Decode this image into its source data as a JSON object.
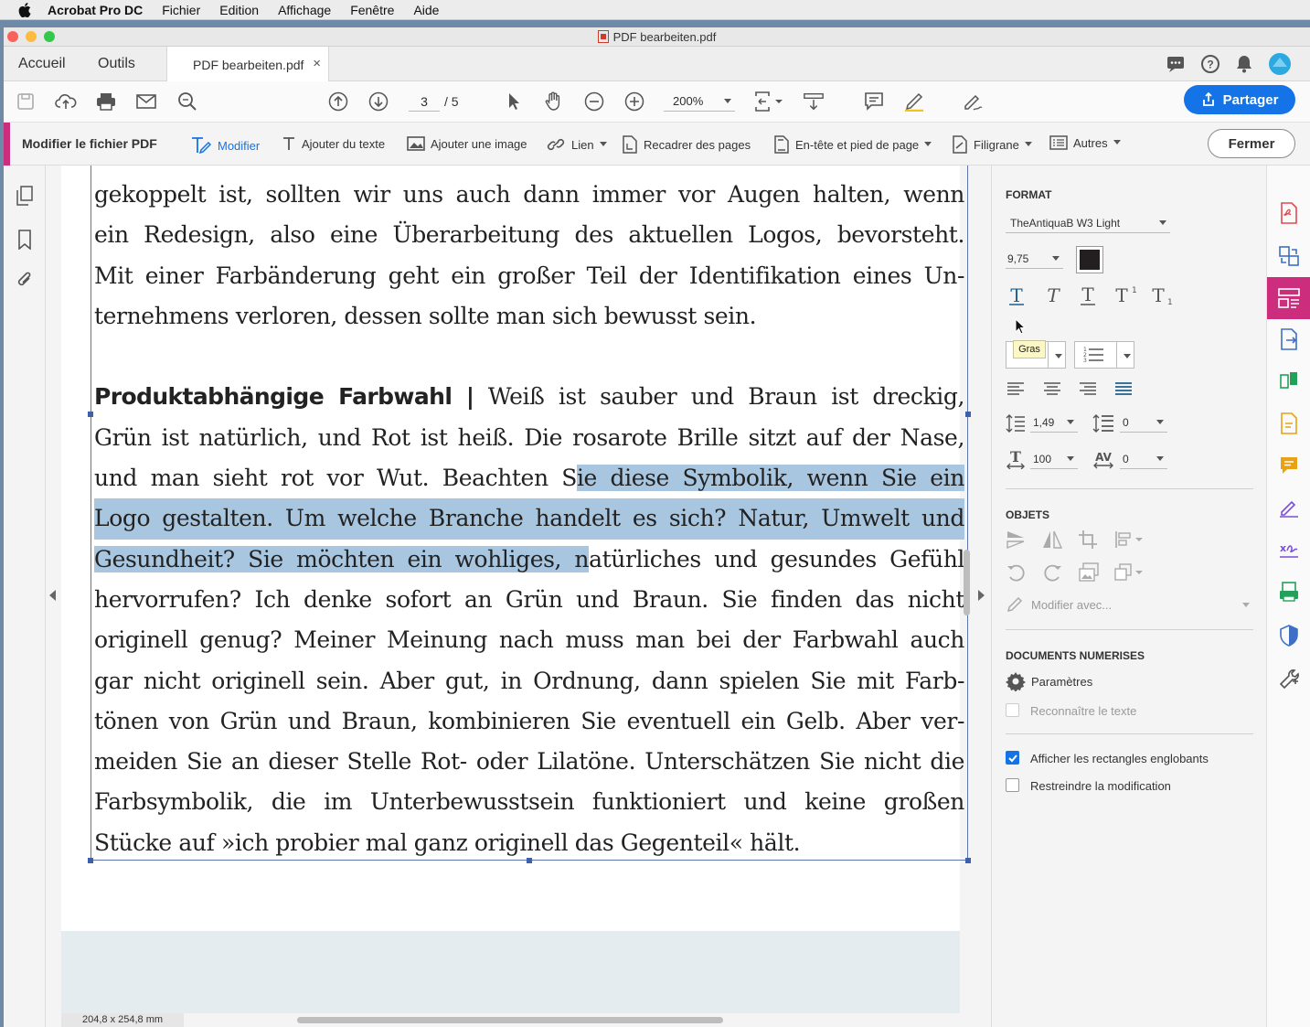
{
  "menubar": {
    "app": "Acrobat Pro DC",
    "items": [
      "Fichier",
      "Edition",
      "Affichage",
      "Fenêtre",
      "Aide"
    ]
  },
  "window": {
    "title": "PDF bearbeiten.pdf"
  },
  "tabs": {
    "home": "Accueil",
    "tools": "Outils",
    "doc": "PDF bearbeiten.pdf"
  },
  "toolbar": {
    "page_current": "3",
    "page_total": "/ 5",
    "zoom": "200%",
    "share": "Partager"
  },
  "edit_toolbar": {
    "title": "Modifier le fichier PDF",
    "modify": "Modifier",
    "add_text": "Ajouter du texte",
    "add_image": "Ajouter une image",
    "link": "Lien",
    "crop": "Recadrer des pages",
    "header_footer": "En-tête et pied de page",
    "watermark": "Filigrane",
    "more": "Autres",
    "close": "Fermer"
  },
  "document": {
    "lines": [
      "gekoppelt ist, sollten wir uns auch dann immer vor Augen halten, wenn",
      "ein Redesign, also eine Überarbeitung des aktuellen Logos, bevorsteht.",
      "Mit einer Farbänderung geht ein großer Teil der Identifikation eines Un-",
      "ternehmens verloren, dessen sollte man sich bewusst sein."
    ],
    "heading": "Produktabhängige Farbwahl",
    "heading_sep": "|",
    "p2_line1_rest": "Weiß ist sauber und Braun ist dreckig,",
    "p2_line2": "Grün ist natürlich, und Rot ist heiß. Die rosarote Brille sitzt auf der Nase,",
    "p2_line3_pre": "und man sieht rot vor Wut. Beachten S",
    "p2_line3_sel": "ie diese Symbolik, wenn Sie ein",
    "p2_line4_sel": "Logo gestalten. Um welche Branche handelt es sich? Natur, Umwelt und",
    "p2_line5_sel": "Gesundheit? Sie möchten ein wohliges, n",
    "p2_line5_post": "atürliches und gesundes Gefühl",
    "p2_rest": [
      "hervorrufen? Ich denke sofort an Grün und Braun. Sie finden das nicht",
      "originell genug? Meiner Meinung nach muss man bei der Farbwahl auch",
      "gar nicht originell sein. Aber gut, in Ordnung, dann spielen Sie mit Farb-",
      "tönen von Grün und Braun, kombinieren Sie eventuell ein Gelb. Aber ver-",
      "meiden Sie an dieser Stelle Rot- oder Lilatöne. Unterschätzen Sie nicht die",
      "Farbsymbolik, die im Unterbewusstsein funktioniert und keine großen",
      "Stücke auf »ich probier mal ganz originell das Gegenteil« hält."
    ],
    "dimensions": "204,8 x 254,8 mm"
  },
  "format_panel": {
    "format_heading": "FORMAT",
    "font": "TheAntiquaB W3 Light",
    "font_size": "9,75",
    "tooltip": "Gras",
    "line_spacing": "1,49",
    "para_spacing": "0",
    "h_scale": "100",
    "char_spacing": "0",
    "objects_heading": "OBJETS",
    "modify_with": "Modifier avec...",
    "scanned_heading": "DOCUMENTS NUMERISES",
    "settings": "Paramètres",
    "recognize": "Reconnaître le texte",
    "show_boxes": "Afficher les rectangles englobants",
    "restrict": "Restreindre la modification"
  },
  "colors": {
    "accent": "#1473e6",
    "brand": "#cc2e7d",
    "selection": "#a8c6df"
  }
}
